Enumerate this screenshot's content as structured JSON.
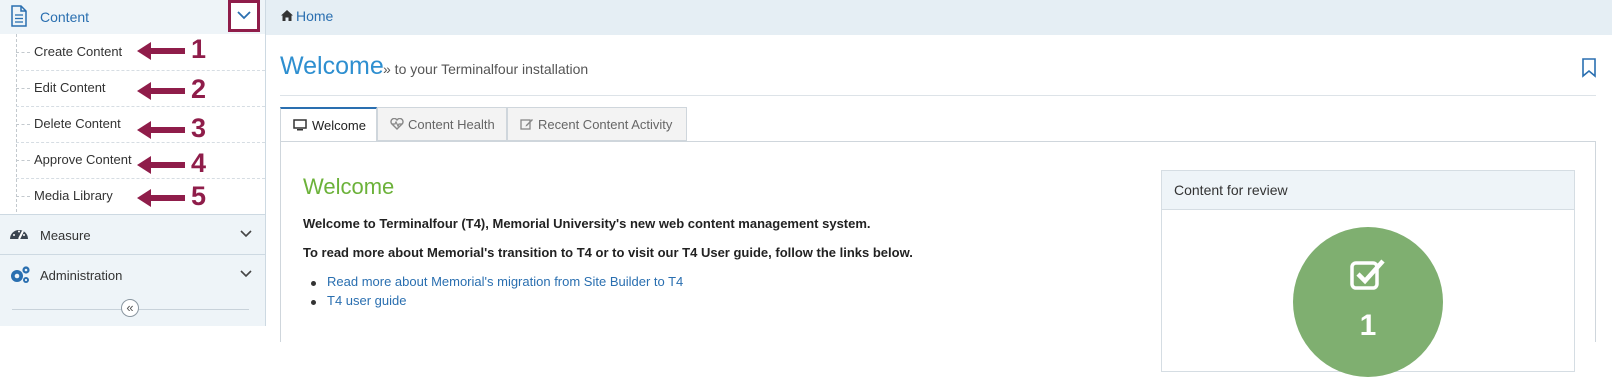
{
  "sidebar": {
    "content_label": "Content",
    "items": [
      {
        "label": "Create Content"
      },
      {
        "label": "Edit Content"
      },
      {
        "label": "Delete Content"
      },
      {
        "label": "Approve Content"
      },
      {
        "label": "Media Library"
      }
    ],
    "measure_label": "Measure",
    "administration_label": "Administration",
    "collapse_glyph": "«"
  },
  "annotations": [
    "1",
    "2",
    "3",
    "4",
    "5"
  ],
  "annotation_color": "#8f1d4a",
  "breadcrumb": {
    "home": "Home"
  },
  "page": {
    "title": "Welcome",
    "subtitle": "» to your Terminalfour installation"
  },
  "tabs": [
    {
      "label": "Welcome",
      "icon": "desktop-icon",
      "active": true
    },
    {
      "label": "Content Health",
      "icon": "heartbeat-icon",
      "active": false
    },
    {
      "label": "Recent Content Activity",
      "icon": "edit-icon",
      "active": false
    }
  ],
  "welcome": {
    "heading": "Welcome",
    "line1": "Welcome to Terminalfour (T4), Memorial University's new web content management system.",
    "line2": "To read more about Memorial's transition to T4 or to visit our T4 User guide, follow the links below.",
    "links": [
      "Read more about Memorial's migration from Site Builder to T4",
      "T4 user guide"
    ]
  },
  "review": {
    "title": "Content for review",
    "count": "1"
  },
  "colors": {
    "link": "#2a6fb0",
    "accent_green": "#6cb23a",
    "review_green": "#7faf70"
  }
}
